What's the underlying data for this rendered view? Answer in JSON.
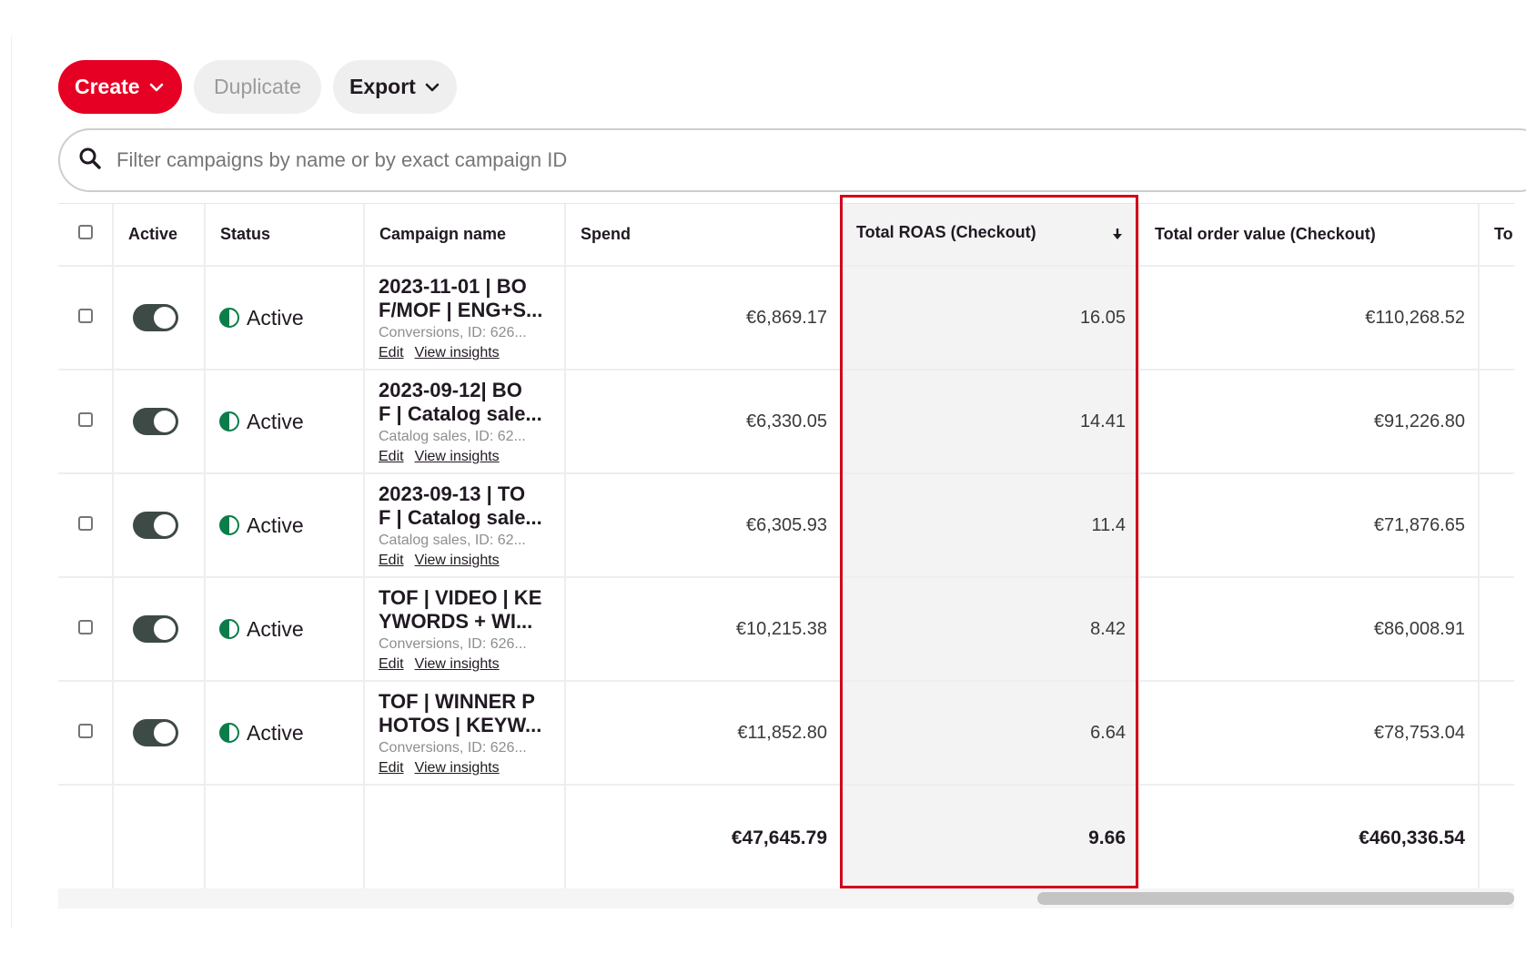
{
  "toolbar": {
    "create_label": "Create",
    "duplicate_label": "Duplicate",
    "export_label": "Export"
  },
  "search": {
    "placeholder": "Filter campaigns by name or by exact campaign ID"
  },
  "table": {
    "columns": {
      "active": "Active",
      "status": "Status",
      "campaign_name": "Campaign name",
      "spend": "Spend",
      "roas": "Total ROAS (Checkout)",
      "order_value": "Total order value (Checkout)",
      "truncated": "To"
    },
    "rows": [
      {
        "status": "Active",
        "name1": "2023-11-01 | BO",
        "name2": "F/MOF | ENG+S...",
        "sub": "Conversions, ID: 626...",
        "edit": "Edit",
        "insights": "View insights",
        "spend": "€6,869.17",
        "roas": "16.05",
        "order_value": "€110,268.52"
      },
      {
        "status": "Active",
        "name1": "2023-09-12| BO",
        "name2": "F | Catalog sale...",
        "sub": "Catalog sales, ID: 62...",
        "edit": "Edit",
        "insights": "View insights",
        "spend": "€6,330.05",
        "roas": "14.41",
        "order_value": "€91,226.80"
      },
      {
        "status": "Active",
        "name1": "2023-09-13 | TO",
        "name2": "F | Catalog sale...",
        "sub": "Catalog sales, ID: 62...",
        "edit": "Edit",
        "insights": "View insights",
        "spend": "€6,305.93",
        "roas": "11.4",
        "order_value": "€71,876.65"
      },
      {
        "status": "Active",
        "name1": "TOF | VIDEO | KE",
        "name2": "YWORDS + WI...",
        "sub": "Conversions, ID: 626...",
        "edit": "Edit",
        "insights": "View insights",
        "spend": "€10,215.38",
        "roas": "8.42",
        "order_value": "€86,008.91"
      },
      {
        "status": "Active",
        "name1": "TOF | WINNER P",
        "name2": "HOTOS | KEYW...",
        "sub": "Conversions, ID: 626...",
        "edit": "Edit",
        "insights": "View insights",
        "spend": "€11,852.80",
        "roas": "6.64",
        "order_value": "€78,753.04"
      }
    ],
    "totals": {
      "spend": "€47,645.79",
      "roas": "9.66",
      "order_value": "€460,336.54"
    }
  },
  "colors": {
    "brand_red": "#e60023",
    "active_green": "#0a7d4a",
    "highlight_border": "#d0021b"
  },
  "icons": [
    "chevron-down-icon",
    "search-icon",
    "sort-descending-icon",
    "status-half-circle-icon"
  ]
}
